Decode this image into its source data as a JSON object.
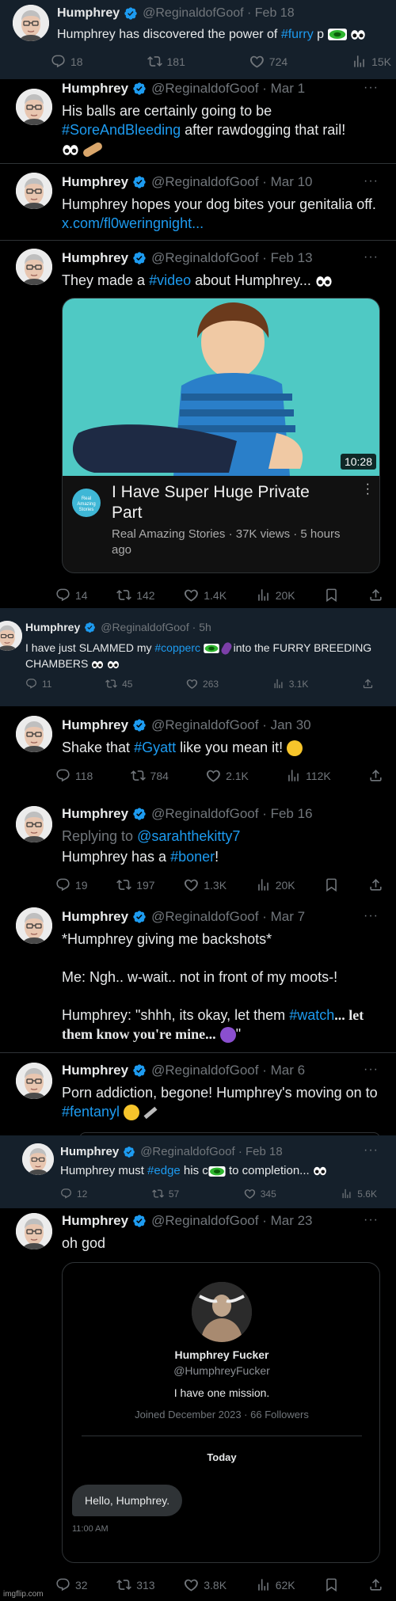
{
  "tweets": [
    {
      "name": "Humphrey",
      "handle": "@ReginaldofGoof",
      "date": "Feb 18",
      "text_a": "Humphrey has discovered the power of ",
      "tag": "#furry",
      "text_b": " p",
      "replies": "18",
      "retweets": "181",
      "likes": "724",
      "views": "15K"
    },
    {
      "name": "Humphrey",
      "handle": "@ReginaldofGoof",
      "date": "Mar 1",
      "text_a": "His balls are certainly going to be",
      "tag": "#SoreAndBleeding",
      "text_b": " after rawdogging that rail!"
    },
    {
      "name": "Humphrey",
      "handle": "@ReginaldofGoof",
      "date": "Mar 10",
      "text_a": "Humphrey hopes your dog bites your genitalia off. ",
      "link": "x.com/fl0weringnight..."
    },
    {
      "name": "Humphrey",
      "handle": "@ReginaldofGoof",
      "date": "Feb 13",
      "text_a": "They made a ",
      "tag": "#video",
      "text_b": " about Humphrey...",
      "video": {
        "duration": "10:28",
        "title": "I Have Super Huge Private Part",
        "channel": "Real Amazing Stories",
        "meta": "Real Amazing Stories · 37K views · 5 hours ago",
        "logo": "Real Amazing Stories"
      },
      "replies": "14",
      "retweets": "142",
      "likes": "1.4K",
      "views": "20K"
    },
    {
      "name": "Humphrey",
      "handle": "@ReginaldofGoof",
      "date": "5h",
      "text_a": "I have just SLAMMED my ",
      "tag": "#copperc",
      "text_b": " into the FURRY BREEDING CHAMBERS",
      "replies": "11",
      "retweets": "45",
      "likes": "263",
      "views": "3.1K"
    },
    {
      "name": "Humphrey",
      "handle": "@ReginaldofGoof",
      "date": "Jan 30",
      "text_a": "Shake that ",
      "tag": "#Gyatt",
      "text_b": " like you mean it!",
      "replies": "118",
      "retweets": "784",
      "likes": "2.1K",
      "views": "112K"
    },
    {
      "name": "Humphrey",
      "handle": "@ReginaldofGoof",
      "date": "Feb 16",
      "replying": "Replying to ",
      "replying_to": "@sarahthekitty7",
      "text_a": "Humphrey has a ",
      "tag": "#boner",
      "text_b": "!",
      "replies": "19",
      "retweets": "197",
      "likes": "1.3K",
      "views": "20K"
    },
    {
      "name": "Humphrey",
      "handle": "@ReginaldofGoof",
      "date": "Mar 7",
      "line1": "*Humphrey giving me backshots*",
      "line2": "Me: Ngh.. w-wait.. not in front of my moots-!",
      "line3_a": "Humphrey: \"shhh, its okay, let them ",
      "tag": "#watch",
      "line3_b": "... let them know you're mine...",
      "line3_c": "\""
    },
    {
      "name": "Humphrey",
      "handle": "@ReginaldofGoof",
      "date": "Mar 6",
      "text_a": "Porn addiction, begone! Humphrey's moving on to ",
      "tag": "#fentanyl"
    },
    {
      "name": "Humphrey",
      "handle": "@ReginaldofGoof",
      "date": "Feb 18",
      "text_a": "Humphrey must ",
      "tag": "#edge",
      "text_b": " his c",
      "text_c": " to completion...",
      "replies": "12",
      "retweets": "57",
      "likes": "345",
      "views": "5.6K"
    },
    {
      "name": "Humphrey",
      "handle": "@ReginaldofGoof",
      "date": "Mar 23",
      "text_a": "oh god",
      "dm": {
        "name": "Humphrey Fucker",
        "handle": "@HumphreyFucker",
        "bio": "I have one mission.",
        "joined": "Joined December 2023 · 66 Followers",
        "day": "Today",
        "message": "Hello, Humphrey.",
        "time": "11:00 AM"
      },
      "replies": "32",
      "retweets": "313",
      "likes": "3.8K",
      "views": "62K"
    }
  ],
  "watermark": "imgflip.com"
}
